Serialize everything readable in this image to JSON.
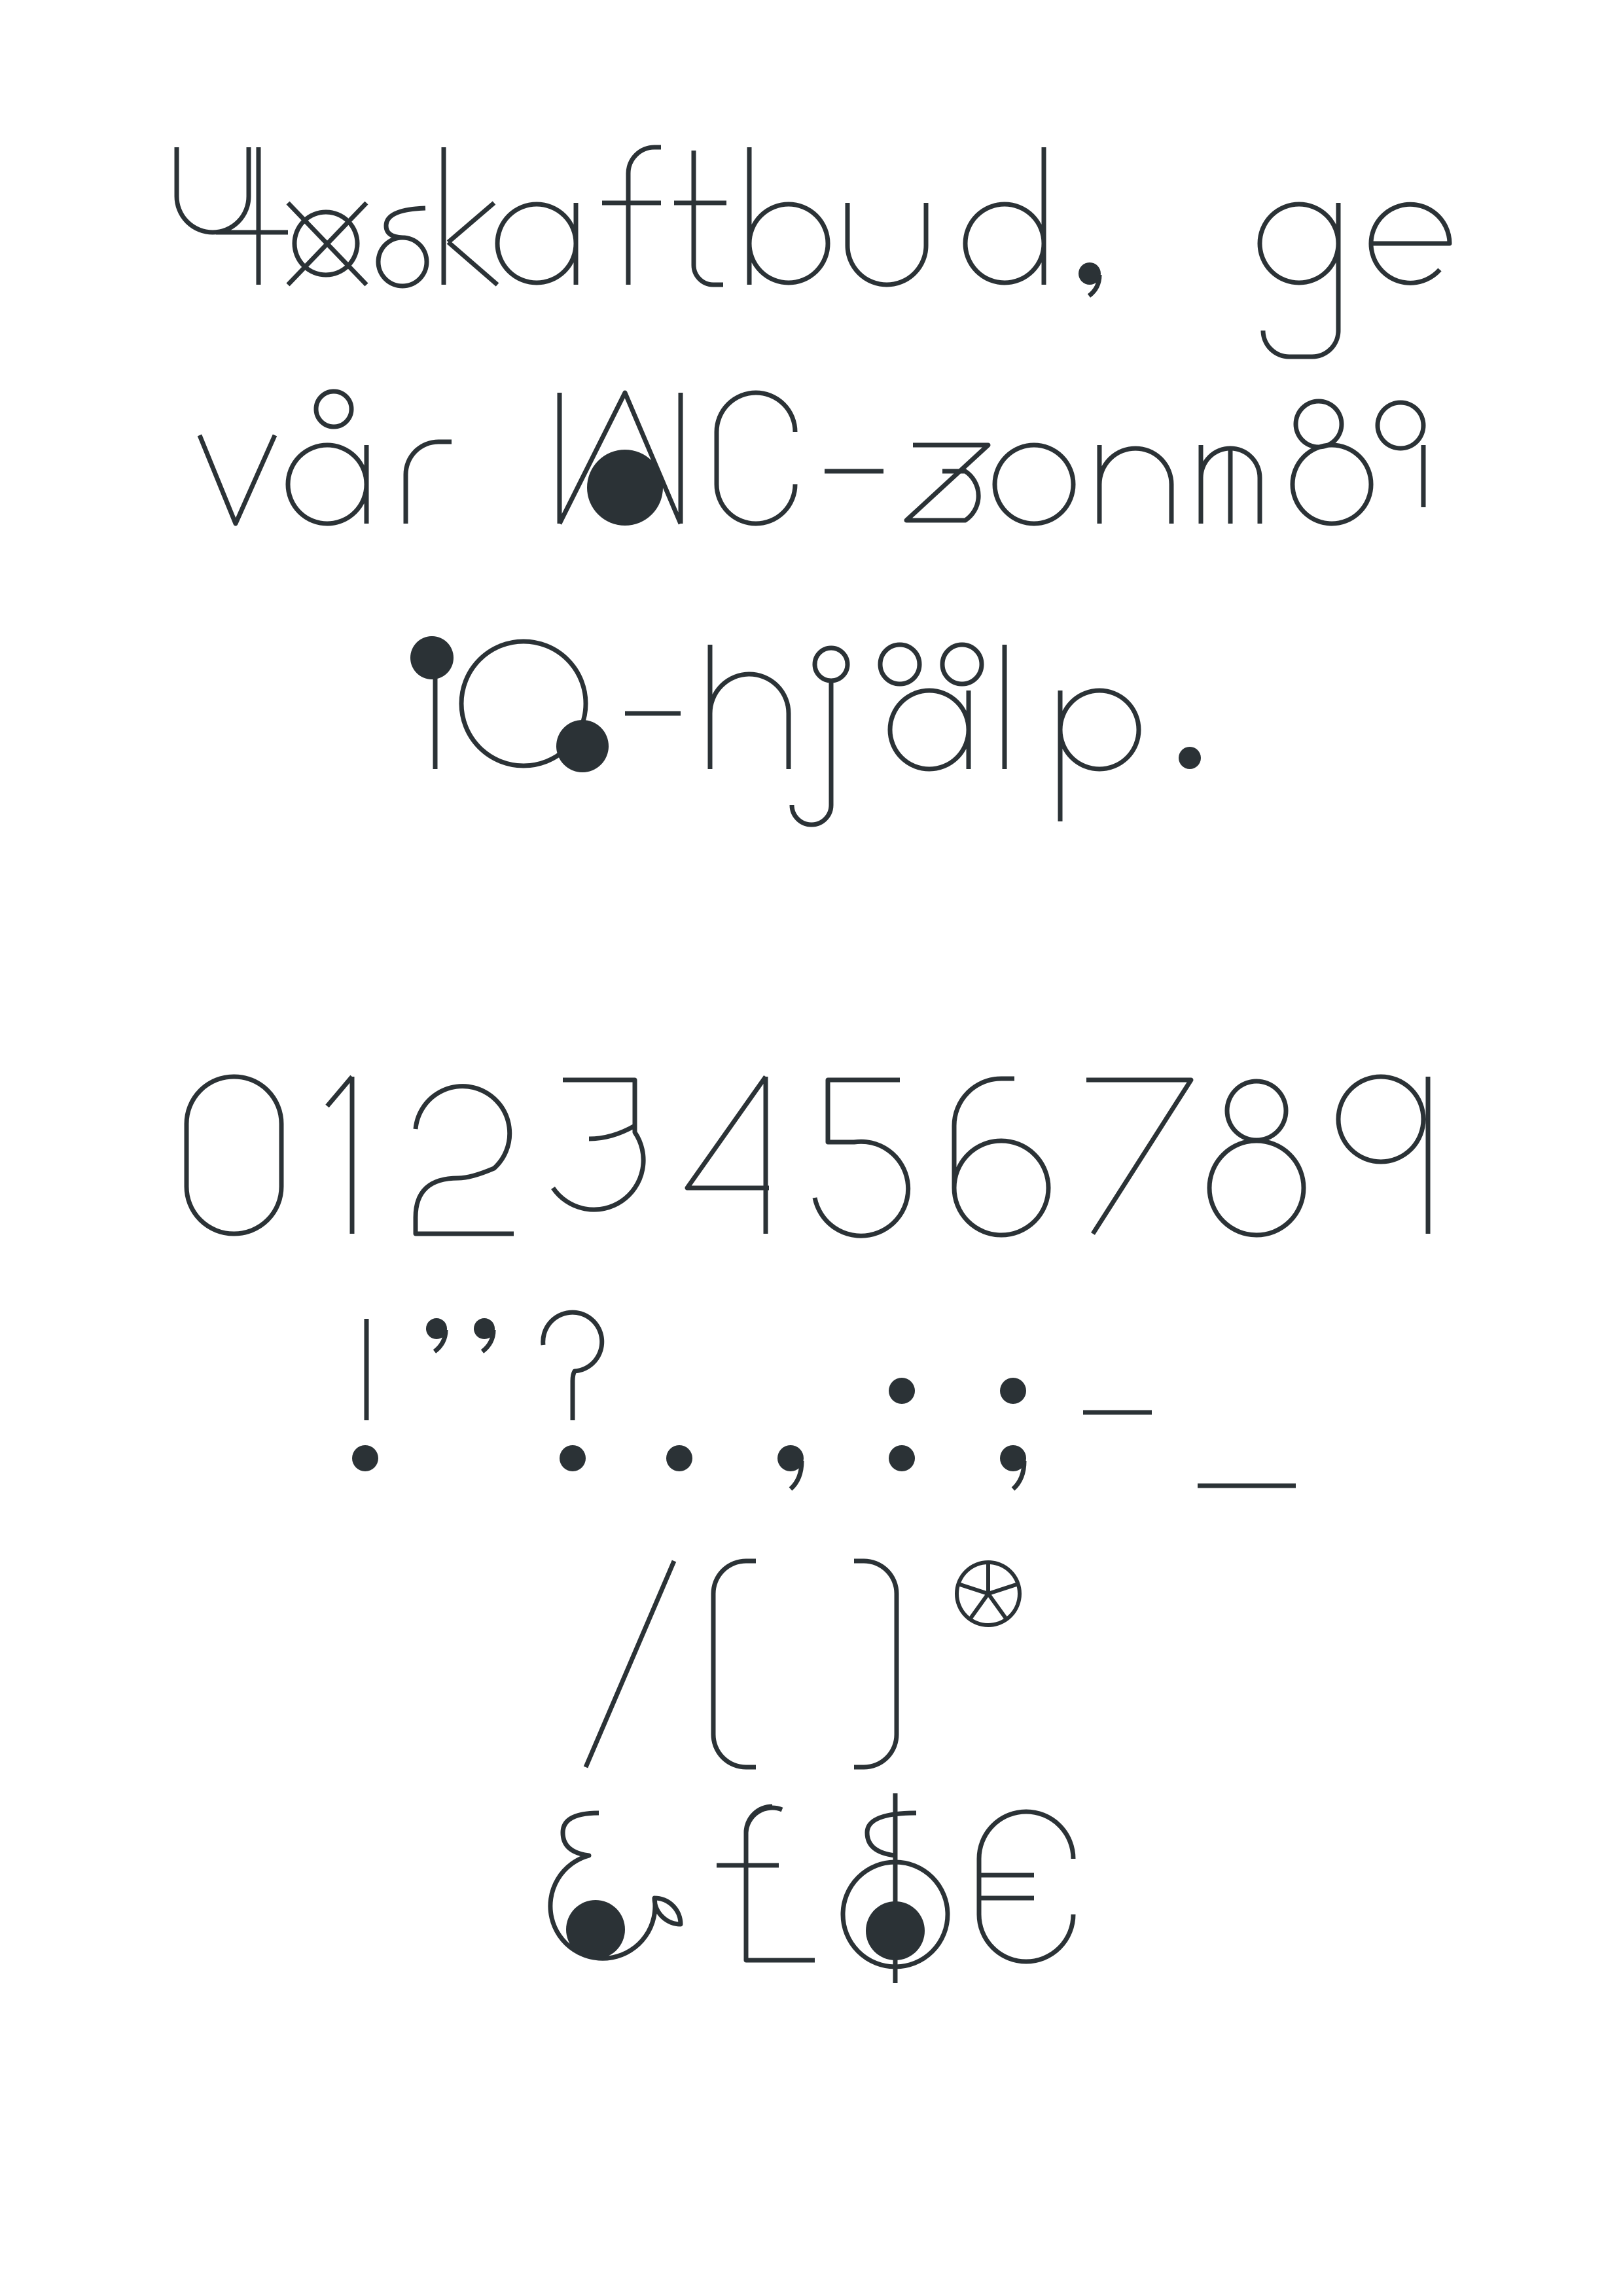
{
  "specimen": {
    "pangram_lines": [
      "Yxskaftbud, ge",
      "vår WC-zonmö",
      "IQ-hjälp."
    ],
    "digits": "0123456789",
    "punctuation": "!\"?.,:;-_",
    "brackets": "/()*",
    "currency": "&£$€"
  },
  "colors": {
    "ink": "#2b3236",
    "paper": "#ffffff"
  }
}
